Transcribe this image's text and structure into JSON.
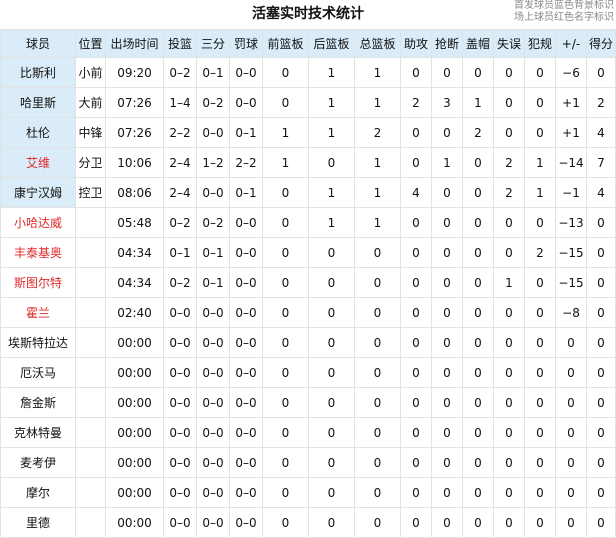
{
  "title": "活塞实时技术统计",
  "legend": [
    "首发球员蓝色背景标识",
    "场上球员红色名字标识"
  ],
  "colors": {
    "starter_bg": "#d9ecf8",
    "on_court_name": "#e02a2a",
    "header_bg": "#d9ecf8"
  },
  "columns": [
    "球员",
    "位置",
    "出场时间",
    "投篮",
    "三分",
    "罚球",
    "前篮板",
    "后篮板",
    "总篮板",
    "助攻",
    "抢断",
    "盖帽",
    "失误",
    "犯规",
    "+/-",
    "得分"
  ],
  "players": [
    {
      "name": "比斯利",
      "pos": "小前",
      "min": "09:20",
      "fg": "0–2",
      "tp": "0–1",
      "ft": "0–0",
      "oreb": "0",
      "dreb": "1",
      "reb": "1",
      "ast": "0",
      "stl": "0",
      "blk": "0",
      "tov": "0",
      "pf": "0",
      "pm": "−6",
      "pts": "0",
      "starter": true,
      "on_court": false
    },
    {
      "name": "哈里斯",
      "pos": "大前",
      "min": "07:26",
      "fg": "1–4",
      "tp": "0–2",
      "ft": "0–0",
      "oreb": "0",
      "dreb": "1",
      "reb": "1",
      "ast": "2",
      "stl": "3",
      "blk": "1",
      "tov": "0",
      "pf": "0",
      "pm": "+1",
      "pts": "2",
      "starter": true,
      "on_court": false
    },
    {
      "name": "杜伦",
      "pos": "中锋",
      "min": "07:26",
      "fg": "2–2",
      "tp": "0–0",
      "ft": "0–1",
      "oreb": "1",
      "dreb": "1",
      "reb": "2",
      "ast": "0",
      "stl": "0",
      "blk": "2",
      "tov": "0",
      "pf": "0",
      "pm": "+1",
      "pts": "4",
      "starter": true,
      "on_court": false
    },
    {
      "name": "艾维",
      "pos": "分卫",
      "min": "10:06",
      "fg": "2–4",
      "tp": "1–2",
      "ft": "2–2",
      "oreb": "1",
      "dreb": "0",
      "reb": "1",
      "ast": "0",
      "stl": "1",
      "blk": "0",
      "tov": "2",
      "pf": "1",
      "pm": "−14",
      "pts": "7",
      "starter": true,
      "on_court": true
    },
    {
      "name": "康宁汉姆",
      "pos": "控卫",
      "min": "08:06",
      "fg": "2–4",
      "tp": "0–0",
      "ft": "0–1",
      "oreb": "0",
      "dreb": "1",
      "reb": "1",
      "ast": "4",
      "stl": "0",
      "blk": "0",
      "tov": "2",
      "pf": "1",
      "pm": "−1",
      "pts": "4",
      "starter": true,
      "on_court": false
    },
    {
      "name": "小哈达威",
      "pos": "",
      "min": "05:48",
      "fg": "0–2",
      "tp": "0–2",
      "ft": "0–0",
      "oreb": "0",
      "dreb": "1",
      "reb": "1",
      "ast": "0",
      "stl": "0",
      "blk": "0",
      "tov": "0",
      "pf": "0",
      "pm": "−13",
      "pts": "0",
      "starter": false,
      "on_court": true
    },
    {
      "name": "丰泰基奥",
      "pos": "",
      "min": "04:34",
      "fg": "0–1",
      "tp": "0–1",
      "ft": "0–0",
      "oreb": "0",
      "dreb": "0",
      "reb": "0",
      "ast": "0",
      "stl": "0",
      "blk": "0",
      "tov": "0",
      "pf": "2",
      "pm": "−15",
      "pts": "0",
      "starter": false,
      "on_court": true
    },
    {
      "name": "斯图尔特",
      "pos": "",
      "min": "04:34",
      "fg": "0–2",
      "tp": "0–1",
      "ft": "0–0",
      "oreb": "0",
      "dreb": "0",
      "reb": "0",
      "ast": "0",
      "stl": "0",
      "blk": "0",
      "tov": "1",
      "pf": "0",
      "pm": "−15",
      "pts": "0",
      "starter": false,
      "on_court": true
    },
    {
      "name": "霍兰",
      "pos": "",
      "min": "02:40",
      "fg": "0–0",
      "tp": "0–0",
      "ft": "0–0",
      "oreb": "0",
      "dreb": "0",
      "reb": "0",
      "ast": "0",
      "stl": "0",
      "blk": "0",
      "tov": "0",
      "pf": "0",
      "pm": "−8",
      "pts": "0",
      "starter": false,
      "on_court": true
    },
    {
      "name": "埃斯特拉达",
      "pos": "",
      "min": "00:00",
      "fg": "0–0",
      "tp": "0–0",
      "ft": "0–0",
      "oreb": "0",
      "dreb": "0",
      "reb": "0",
      "ast": "0",
      "stl": "0",
      "blk": "0",
      "tov": "0",
      "pf": "0",
      "pm": "0",
      "pts": "0",
      "starter": false,
      "on_court": false
    },
    {
      "name": "厄沃马",
      "pos": "",
      "min": "00:00",
      "fg": "0–0",
      "tp": "0–0",
      "ft": "0–0",
      "oreb": "0",
      "dreb": "0",
      "reb": "0",
      "ast": "0",
      "stl": "0",
      "blk": "0",
      "tov": "0",
      "pf": "0",
      "pm": "0",
      "pts": "0",
      "starter": false,
      "on_court": false
    },
    {
      "name": "詹金斯",
      "pos": "",
      "min": "00:00",
      "fg": "0–0",
      "tp": "0–0",
      "ft": "0–0",
      "oreb": "0",
      "dreb": "0",
      "reb": "0",
      "ast": "0",
      "stl": "0",
      "blk": "0",
      "tov": "0",
      "pf": "0",
      "pm": "0",
      "pts": "0",
      "starter": false,
      "on_court": false
    },
    {
      "name": "克林特曼",
      "pos": "",
      "min": "00:00",
      "fg": "0–0",
      "tp": "0–0",
      "ft": "0–0",
      "oreb": "0",
      "dreb": "0",
      "reb": "0",
      "ast": "0",
      "stl": "0",
      "blk": "0",
      "tov": "0",
      "pf": "0",
      "pm": "0",
      "pts": "0",
      "starter": false,
      "on_court": false
    },
    {
      "name": "麦考伊",
      "pos": "",
      "min": "00:00",
      "fg": "0–0",
      "tp": "0–0",
      "ft": "0–0",
      "oreb": "0",
      "dreb": "0",
      "reb": "0",
      "ast": "0",
      "stl": "0",
      "blk": "0",
      "tov": "0",
      "pf": "0",
      "pm": "0",
      "pts": "0",
      "starter": false,
      "on_court": false
    },
    {
      "name": "摩尔",
      "pos": "",
      "min": "00:00",
      "fg": "0–0",
      "tp": "0–0",
      "ft": "0–0",
      "oreb": "0",
      "dreb": "0",
      "reb": "0",
      "ast": "0",
      "stl": "0",
      "blk": "0",
      "tov": "0",
      "pf": "0",
      "pm": "0",
      "pts": "0",
      "starter": false,
      "on_court": false
    },
    {
      "name": "里德",
      "pos": "",
      "min": "00:00",
      "fg": "0–0",
      "tp": "0–0",
      "ft": "0–0",
      "oreb": "0",
      "dreb": "0",
      "reb": "0",
      "ast": "0",
      "stl": "0",
      "blk": "0",
      "tov": "0",
      "pf": "0",
      "pm": "0",
      "pts": "0",
      "starter": false,
      "on_court": false
    }
  ]
}
